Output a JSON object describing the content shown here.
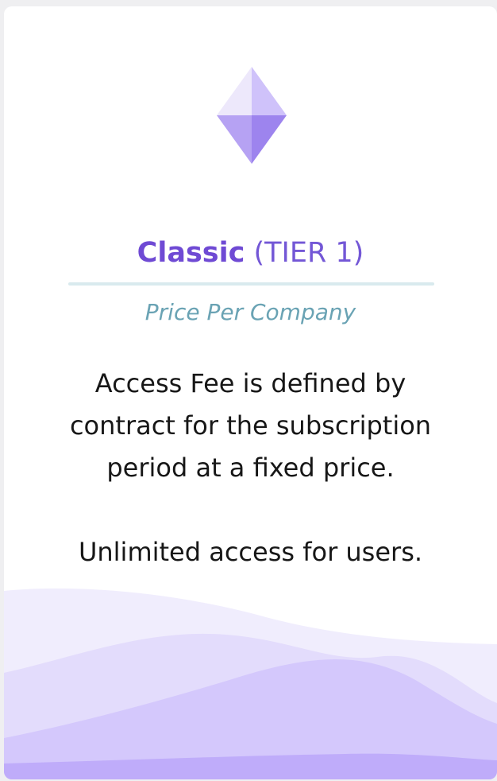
{
  "plan": {
    "name": "Classic",
    "tier": "(TIER 1)",
    "price_basis": "Price Per Company",
    "description_lines": [
      "Access Fee is defined by",
      "contract for the subscription",
      "period at a fixed price."
    ],
    "extra_line": "Unlimited access for users."
  },
  "icons": {
    "plan_icon": "diamond-gem-icon"
  },
  "colors": {
    "accent": "#6f4ad4",
    "subtitle": "#6aa3b4",
    "divider": "#d9eaee",
    "gem_light": "#ede8fb",
    "gem_mid": "#b6a2f3",
    "gem_dark": "#9d84ee"
  }
}
